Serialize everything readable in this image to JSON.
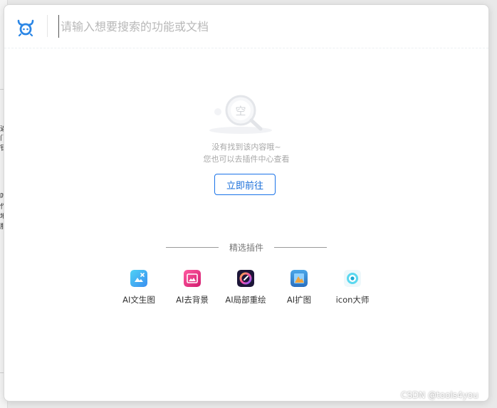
{
  "search": {
    "placeholder": "请输入想要搜索的功能或文档"
  },
  "empty": {
    "illustration_char": "空",
    "line1": "没有找到该内容哦~",
    "line2": "您也可以去插件中心查看",
    "button_label": "立即前往"
  },
  "featured": {
    "title": "精选插件",
    "plugins": [
      {
        "label": "AI文生图",
        "icon": "ai-text-to-image-icon"
      },
      {
        "label": "AI去背景",
        "icon": "ai-remove-background-icon"
      },
      {
        "label": "AI局部重绘",
        "icon": "ai-inpaint-icon"
      },
      {
        "label": "AI扩图",
        "icon": "ai-outpaint-icon"
      },
      {
        "label": "icon大师",
        "icon": "icon-master-icon"
      }
    ]
  },
  "watermark": "CSDN @tools4you",
  "background_text": [
    "逼",
    "门",
    "钆",
    "吋",
    "作",
    "地",
    "服"
  ],
  "colors": {
    "accent": "#1a73e8",
    "logo": "#2a86e6"
  }
}
